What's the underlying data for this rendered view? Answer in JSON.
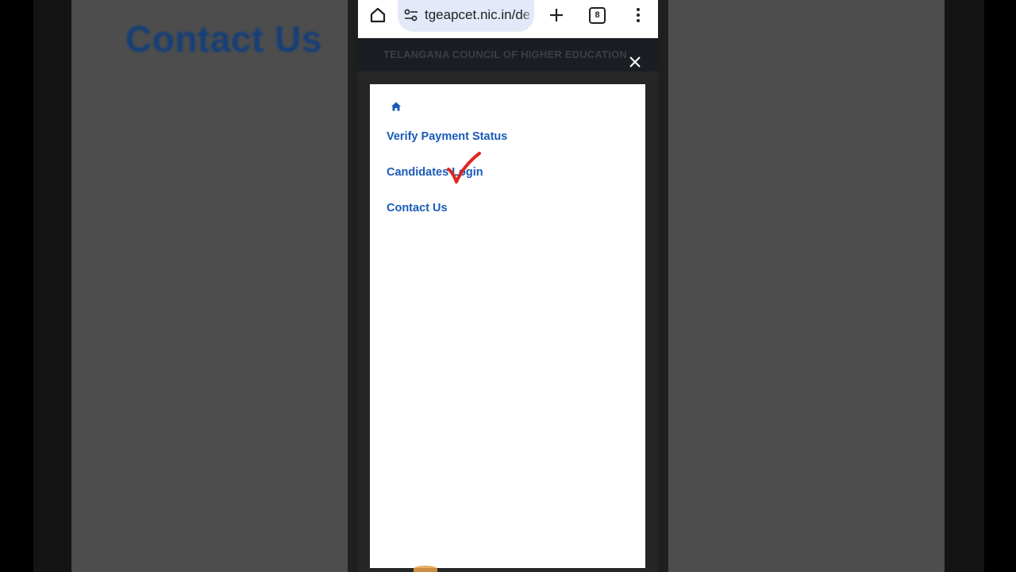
{
  "background": {
    "title": "Contact Us"
  },
  "browser": {
    "url": "tgeapcet.nic.in/de",
    "tab_count": "8",
    "icons": [
      "home-icon",
      "site-settings-icon",
      "new-tab-icon",
      "tab-switcher-icon",
      "more-menu-icon"
    ]
  },
  "site": {
    "header": "TELANGANA COUNCIL OF HIGHER EDUCATION"
  },
  "menu": {
    "items": [
      {
        "label": "Verify Payment Status"
      },
      {
        "label": "Candidates Login"
      },
      {
        "label": "Contact Us"
      }
    ]
  },
  "colors": {
    "link": "#1a5bb8",
    "checkmark": "#e0261f",
    "url_pill": "#e3e9f8"
  }
}
